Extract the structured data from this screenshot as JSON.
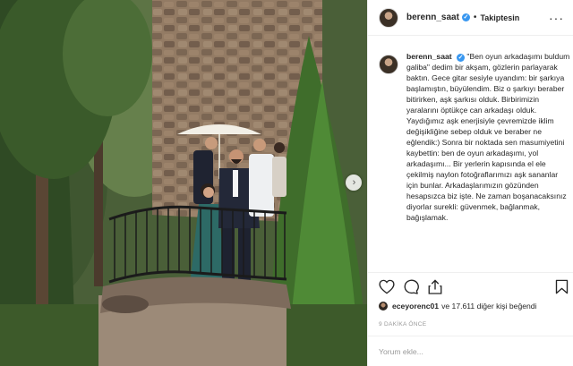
{
  "post": {
    "username": "berenn_saat",
    "verified_icon": "verified-badge-icon",
    "separator": "•",
    "follow_status": "Takiptesin",
    "more_icon": "more-options-icon",
    "caption_username": "berenn_saat",
    "caption_body": "\"Ben oyun arkadaşımı buldum galiba\" dedim bir akşam, gözlerin parlayarak baktın. Gece gitar sesiyle uyandım: bir şarkıya başlamıştın, büyülendim. Biz o şarkıyı beraber bitirirken, aşk şarkısı olduk. Birbirimizin yaralarını öptükçe can arkadaşı olduk. Yaydığımız aşk enerjisiyle çevremizde iklim değişikliğine sebep olduk ve beraber ne eğlendik:) Sonra bir noktada sen masumiyetini kaybettin: ben de oyun arkadaşımı, yol arkadaşımı... Bir yerlerin kapısında el ele çekilmiş naylon fotoğraflarımızı aşk sananlar için bunlar. Arkadaşlarımızın gözünden hesapsızca biz işte. Ne zaman boşanacaksınız diyorlar surekli: güvenmek, bağlanmak, bağışlamak.",
    "likes_user": "eceyorenc01",
    "likes_rest": "ve 17.611 diğer kişi beğendi",
    "time": "9 DAKİKA ÖNCE",
    "comment_placeholder": "Yorum ekle...",
    "next_arrow": "›"
  },
  "actions": [
    "heart-icon",
    "comment-icon",
    "share-icon",
    "bookmark-icon"
  ],
  "colors": {
    "verified": "#3897f0",
    "text": "#262626",
    "muted": "#999999",
    "border": "#efefef"
  }
}
